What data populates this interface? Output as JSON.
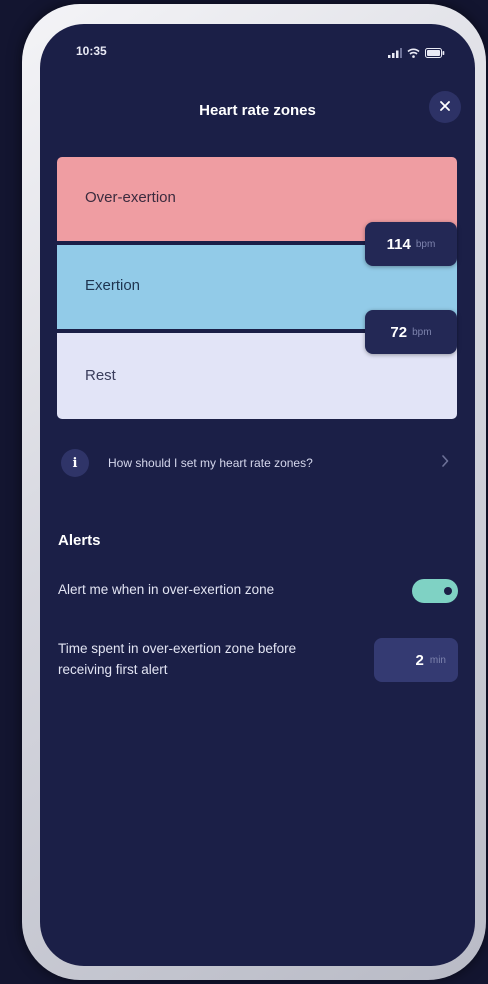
{
  "status_bar": {
    "time": "10:35",
    "icons": [
      "signal-icon",
      "wifi-icon",
      "battery-icon"
    ]
  },
  "header": {
    "title": "Heart rate zones",
    "close_icon": "close-icon"
  },
  "zones": [
    {
      "label": "Over-exertion",
      "color": "#ef9da2"
    },
    {
      "label": "Exertion",
      "color": "#92cbe8"
    },
    {
      "label": "Rest",
      "color": "#e2e4f7"
    }
  ],
  "thresholds": [
    {
      "value": "114",
      "unit": "bpm"
    },
    {
      "value": "72",
      "unit": "bpm"
    }
  ],
  "help": {
    "icon_glyph": "i",
    "text": "How should I set my heart rate zones?"
  },
  "alerts": {
    "heading": "Alerts",
    "toggle_label": "Alert me when in over-exertion zone",
    "toggle_on": true,
    "toggle_color": "#7fd2c4",
    "time_label": "Time spent in over-exertion zone before receiving first alert",
    "time_value": "2",
    "time_unit": "min"
  },
  "colors": {
    "background": "#1b1f47",
    "accent": "#7fd2c4"
  }
}
